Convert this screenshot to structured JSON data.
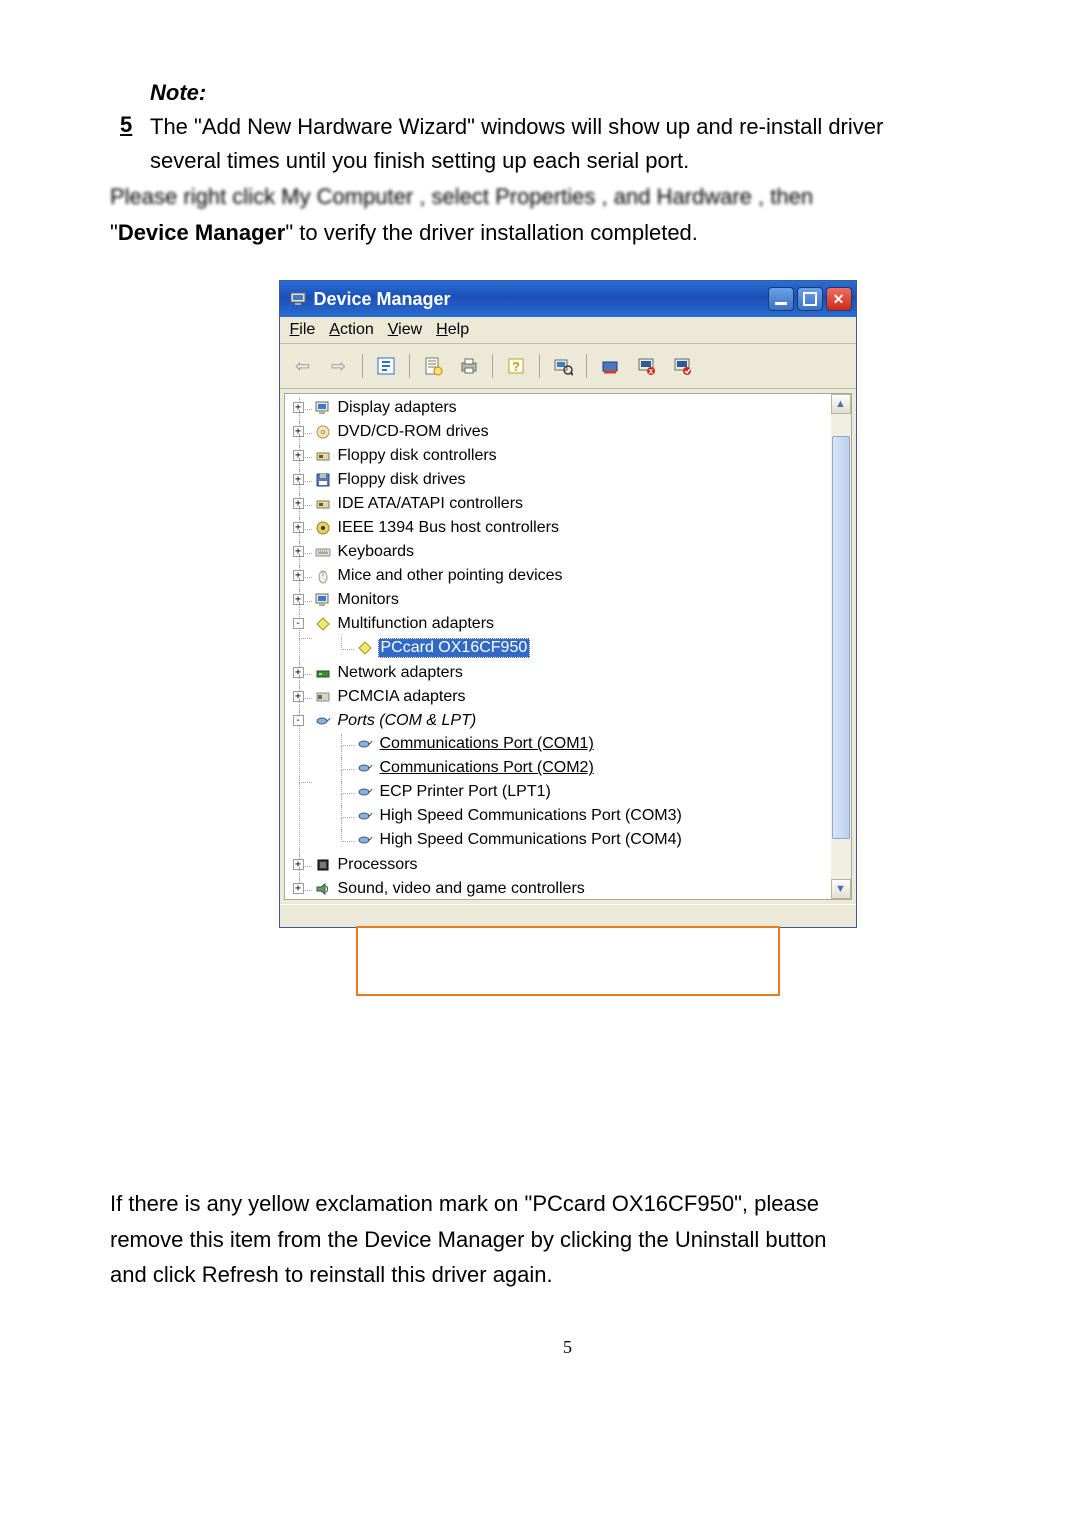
{
  "note_heading": "Note:",
  "step_number": "5",
  "note_body_line1": "The \"Add New Hardware Wizard\" windows will show up and re-install driver",
  "note_body_line2": "several times until you finish setting up each serial port.",
  "blurred_line": "Please right click  My Computer , select  Properties , and  Hardware , then",
  "verify_prefix": "\"",
  "verify_bold": "Device Manager",
  "verify_suffix": "\" to verify the driver installation completed.",
  "devmgr": {
    "title": "Device Manager",
    "menu": {
      "file": "File",
      "action": "Action",
      "view": "View",
      "help": "Help"
    },
    "tree": [
      {
        "label": "Display adapters",
        "expander": "+",
        "icon": "display-icon"
      },
      {
        "label": "DVD/CD-ROM drives",
        "expander": "+",
        "icon": "disc-icon"
      },
      {
        "label": "Floppy disk controllers",
        "expander": "+",
        "icon": "floppy-ctrl-icon"
      },
      {
        "label": "Floppy disk drives",
        "expander": "+",
        "icon": "floppy-drive-icon"
      },
      {
        "label": "IDE ATA/ATAPI controllers",
        "expander": "+",
        "icon": "ide-icon"
      },
      {
        "label": "IEEE 1394 Bus host controllers",
        "expander": "+",
        "icon": "ieee1394-icon"
      },
      {
        "label": "Keyboards",
        "expander": "+",
        "icon": "keyboard-icon"
      },
      {
        "label": "Mice and other pointing devices",
        "expander": "+",
        "icon": "mouse-icon"
      },
      {
        "label": "Monitors",
        "expander": "+",
        "icon": "monitor-icon"
      },
      {
        "label": "Multifunction adapters",
        "expander": "-",
        "icon": "multifunc-icon",
        "children": [
          {
            "label": "PCcard OX16CF950",
            "icon": "multifunc-icon",
            "selected": true
          }
        ]
      },
      {
        "label": "Network adapters",
        "expander": "+",
        "icon": "network-icon"
      },
      {
        "label": "PCMCIA adapters",
        "expander": "+",
        "icon": "pcmcia-icon"
      },
      {
        "label": "Ports (COM & LPT)",
        "expander": "-",
        "icon": "port-icon",
        "italic": true,
        "children": [
          {
            "label": "Communications Port (COM1)",
            "icon": "port-icon",
            "underline": true
          },
          {
            "label": "Communications Port (COM2)",
            "icon": "port-icon",
            "underline": true
          },
          {
            "label": "ECP Printer Port (LPT1)",
            "icon": "port-icon"
          },
          {
            "label": "High Speed Communications Port (COM3)",
            "icon": "port-icon"
          },
          {
            "label": "High Speed Communications Port (COM4)",
            "icon": "port-icon"
          }
        ]
      },
      {
        "label": "Processors",
        "expander": "+",
        "icon": "cpu-icon"
      },
      {
        "label": "Sound, video and game controllers",
        "expander": "+",
        "icon": "sound-icon"
      }
    ]
  },
  "after_text_l1": "If there is any yellow exclamation mark on \"PCcard OX16CF950\", please",
  "after_text_l2": "remove this item from the Device Manager by clicking the Uninstall button",
  "after_text_l3": "and click Refresh to reinstall this driver again.",
  "page_number": "5"
}
